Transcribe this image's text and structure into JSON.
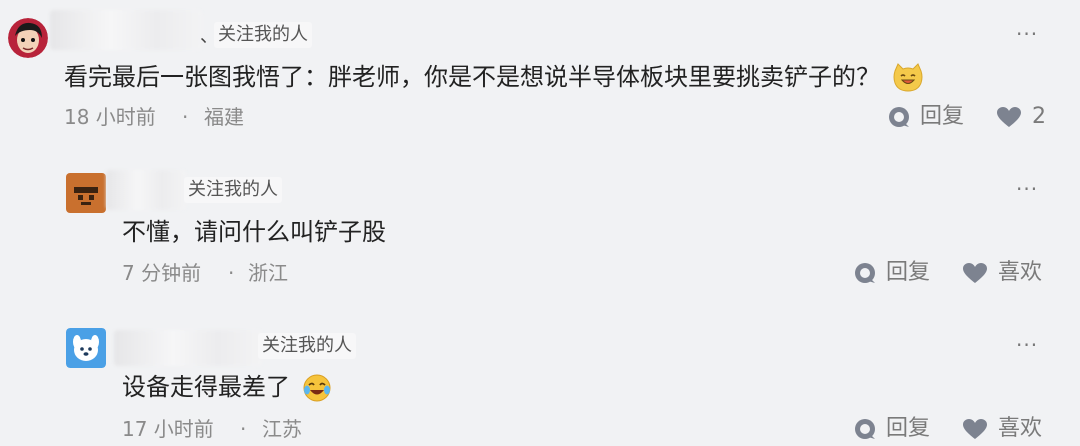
{
  "comments": [
    {
      "follow_label": "关注我的人",
      "separator": "、",
      "text": "看完最后一张图我悟了：胖老师，你是不是想说半导体板块里要挑卖铲子的？",
      "time": "18 小时前",
      "dot": "·",
      "location": "福建",
      "reply_label": "回复",
      "like_count": "2",
      "more": "···",
      "emoji": "grinning-cat-emoji",
      "avatar": "dark-red-cartoon-avatar"
    },
    {
      "follow_label": "关注我的人",
      "text": "不懂，请问什么叫铲子股",
      "time": "7 分钟前",
      "dot": "·",
      "location": "浙江",
      "reply_label": "回复",
      "like_label": "喜欢",
      "more": "···",
      "avatar": "brown-face-avatar"
    },
    {
      "follow_label": "关注我的人",
      "text": "设备走得最差了",
      "time": "17 小时前",
      "dot": "·",
      "location": "江苏",
      "reply_label": "回复",
      "like_label": "喜欢",
      "more": "···",
      "emoji": "crying-laughing-emoji",
      "avatar": "blue-dog-avatar"
    }
  ],
  "colors": {
    "background": "#f1f2f4",
    "text": "#222222",
    "meta": "#8a8a8a",
    "icon": "#8a8f99"
  }
}
